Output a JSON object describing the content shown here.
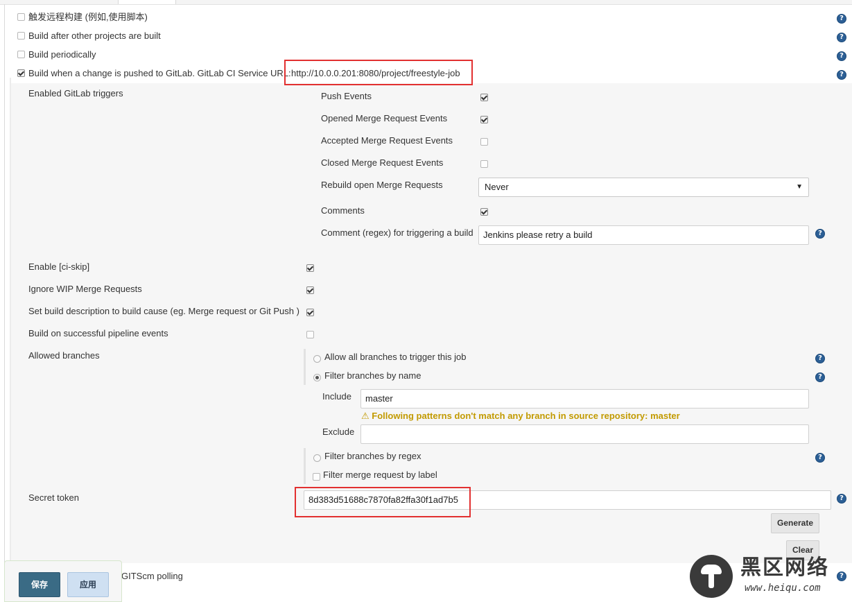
{
  "triggers": [
    {
      "label": "触发远程构建 (例如,使用脚本)",
      "checked": false
    },
    {
      "label": "Build after other projects are built",
      "checked": false
    },
    {
      "label": "Build periodically",
      "checked": false
    },
    {
      "label": "Build when a change is pushed to GitLab. GitLab CI Service URL:",
      "url": "http://10.0.0.201:8080/project/freestyle-job",
      "checked": true
    }
  ],
  "gitlab": {
    "enabled_triggers_label": "Enabled GitLab triggers",
    "events": [
      {
        "label": "Push Events",
        "checked": true
      },
      {
        "label": "Opened Merge Request Events",
        "checked": true
      },
      {
        "label": "Accepted Merge Request Events",
        "checked": false
      },
      {
        "label": "Closed Merge Request Events",
        "checked": false
      }
    ],
    "rebuild_label": "Rebuild open Merge Requests",
    "rebuild_value": "Never",
    "comments_label": "Comments",
    "comments_checked": true,
    "comment_regex_label": "Comment (regex) for triggering a build",
    "comment_regex_value": "Jenkins please retry a build",
    "options": [
      {
        "label": "Enable [ci-skip]",
        "checked": true
      },
      {
        "label": "Ignore WIP Merge Requests",
        "checked": true
      },
      {
        "label": "Set build description to build cause (eg. Merge request or Git Push )",
        "checked": true
      },
      {
        "label": "Build on successful pipeline events",
        "checked": false
      }
    ],
    "allowed_branches_label": "Allowed branches",
    "branch_options": {
      "all": "Allow all branches to trigger this job",
      "by_name": "Filter branches by name",
      "by_regex": "Filter branches by regex",
      "by_label": "Filter merge request by label"
    },
    "selected_branch_option": "by_name",
    "include_label": "Include",
    "include_value": "master",
    "warning": "Following patterns don't match any branch in source repository: master",
    "exclude_label": "Exclude",
    "exclude_value": "",
    "secret_token_label": "Secret token",
    "secret_token_value": "8d383d51688c7870fa82ffa30f1ad7b5",
    "generate_label": "Generate",
    "clear_label": "Clear"
  },
  "partial_row": {
    "label_visible": "GITScm polling"
  },
  "footer": {
    "save_label": "保存",
    "apply_label": "应用"
  },
  "watermark": {
    "brand": "黑区网络",
    "url": "www.heiqu.com"
  },
  "colors": {
    "help_icon": "#2c5f95",
    "highlight": "#e23030",
    "warning": "#c29a00",
    "save_button": "#3a6b85"
  }
}
